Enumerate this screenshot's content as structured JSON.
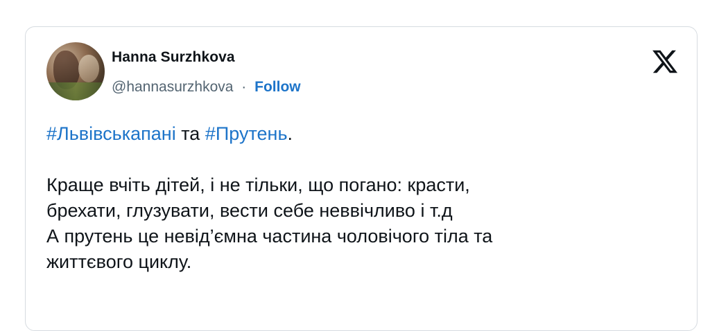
{
  "tweet": {
    "author": {
      "name": "Hanna Surzhkova",
      "handle": "@hannasurzhkova",
      "separator": "·",
      "follow_label": "Follow"
    },
    "platform_icon": "x-logo-icon",
    "text": {
      "hashtag1": "#Львівськапані",
      "connector": " та ",
      "hashtag2": "#Прутень",
      "end_period": ".",
      "line1": "Краще вчіть дітей, і не тільки, що погано: красти,",
      "line2": "брехати, глузувати, вести себе неввічливо і т.д",
      "line3": "А прутень це невід’ємна частина чоловічого тіла та",
      "line4": "життєвого циклу."
    },
    "colors": {
      "link": "#1d74c9",
      "text": "#0f1419",
      "secondary": "#536471",
      "border": "#d6dbe0"
    }
  }
}
